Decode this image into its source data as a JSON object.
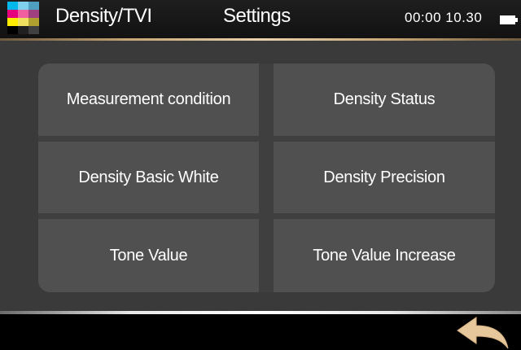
{
  "header": {
    "app_title": "Density/TVI",
    "page_title": "Settings",
    "clock": "00:00 10.30"
  },
  "tiles": [
    {
      "label": "Measurement condition"
    },
    {
      "label": "Density Status"
    },
    {
      "label": "Density Basic White"
    },
    {
      "label": "Density Precision"
    },
    {
      "label": "Tone Value"
    },
    {
      "label": "Tone Value Increase"
    }
  ],
  "icons": {
    "logo": "cmyk-logo-icon",
    "battery": "battery-icon",
    "back": "back-arrow-icon"
  },
  "colors": {
    "cyan": "#00b7eb",
    "magenta": "#e6007e",
    "yellow": "#ffec00",
    "accent_gold": "#c8a677",
    "back_arrow": "#e6c79c"
  }
}
